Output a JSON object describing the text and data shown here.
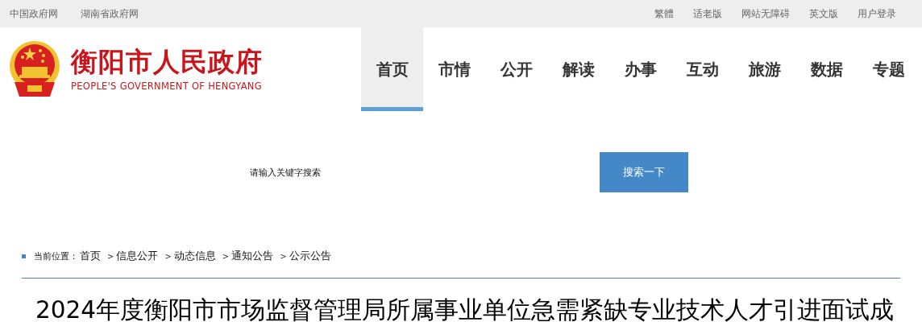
{
  "top_bar": {
    "left_links": [
      "中国政府网",
      "湖南省政府网"
    ],
    "right_links": [
      "繁體",
      "适老版",
      "网站无障碍",
      "英文版",
      "用户登录"
    ]
  },
  "header": {
    "site_name": "衡阳市人民政府",
    "site_name_en": "PEOPLE'S GOVERNMENT OF HENGYANG",
    "nav": [
      {
        "label": "首页",
        "selected": true
      },
      {
        "label": "市情",
        "selected": false
      },
      {
        "label": "公开",
        "selected": false
      },
      {
        "label": "解读",
        "selected": false
      },
      {
        "label": "办事",
        "selected": false
      },
      {
        "label": "互动",
        "selected": false
      },
      {
        "label": "旅游",
        "selected": false
      },
      {
        "label": "数据",
        "selected": false
      },
      {
        "label": "专题",
        "selected": false
      }
    ]
  },
  "search": {
    "placeholder": "请输入关键字搜索",
    "button": "搜索一下"
  },
  "breadcrumb": {
    "label": "当前位置：",
    "items": [
      "首页",
      "信息公开",
      "动态信息",
      "通知公告",
      "公示公告"
    ],
    "separator": ">"
  },
  "article": {
    "title": "2024年度衡阳市市场监督管理局所属事业单位急需紧缺专业技术人才引进面试成"
  }
}
